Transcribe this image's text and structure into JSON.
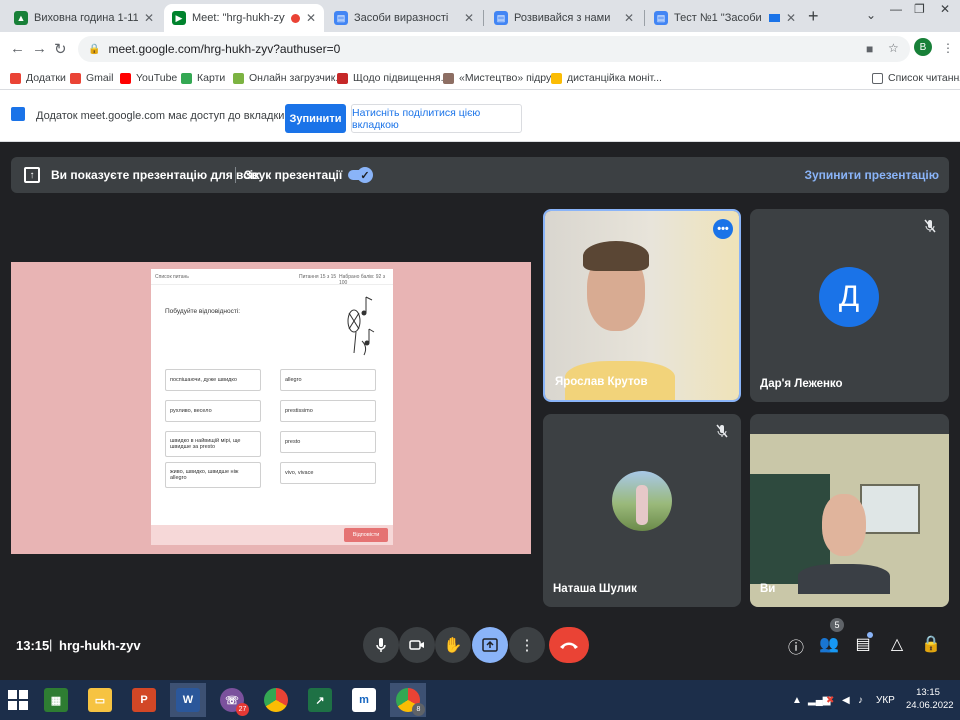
{
  "tabs": [
    {
      "label": "Виховна година 1-11 класи",
      "color": "#188038"
    },
    {
      "label": "Meet: \"hrg-hukh-zyv\"",
      "color": "#00832d"
    },
    {
      "label": "Засоби виразності",
      "color": "#4285f4"
    },
    {
      "label": "Розвивайся з нами",
      "color": "#4285f4"
    },
    {
      "label": "Тест №1 \"Засоби вираз",
      "color": "#4285f4"
    }
  ],
  "address": {
    "url": "meet.google.com/hrg-hukh-zyv?authuser=0"
  },
  "profile_letter": "В",
  "bookmarks": [
    {
      "label": "Додатки",
      "color": "#ea4335"
    },
    {
      "label": "Gmail",
      "color": "#ea4335"
    },
    {
      "label": "YouTube",
      "color": "#ff0000"
    },
    {
      "label": "Карти",
      "color": "#34a853"
    },
    {
      "label": "Онлайн загрузчик...",
      "color": "#7cb342"
    },
    {
      "label": "Щодо підвищення...",
      "color": "#c62828"
    },
    {
      "label": "«Мистецтво» підру...",
      "color": "#8d6e63"
    },
    {
      "label": "дистанційка моніт...",
      "color": "#fbbc04"
    }
  ],
  "reading_list": "Список читання",
  "infobar": {
    "message": "Додаток meet.google.com має доступ до вкладки lyssi.net",
    "stop": "Зупинити",
    "share": "Натисніть поділитися цією вкладкою"
  },
  "banner": {
    "presenting": "Ви показуєте презентацію для всіх",
    "sound": "Звук презентації",
    "stop": "Зупинити презентацію"
  },
  "quiz": {
    "header_left": "Список питань",
    "header_mid": "Питання 15 з 15",
    "header_right": "Набрано балів: 92 з 100",
    "title": "Побудуйте відповідності:",
    "left": [
      "поспішаючи, дуже швидко",
      "рухливо, весело",
      "швидко в найвищій мірі, ще швидше за presto",
      "живо, швидко, швидше ніж allegro"
    ],
    "right": [
      "allegro",
      "prestissimo",
      "presto",
      "vivo, vivace"
    ],
    "answer_btn": "Відповісти"
  },
  "participants": [
    {
      "name": "Ярослав Крутов"
    },
    {
      "name": "Дар'я Леженко",
      "initial": "Д"
    },
    {
      "name": "Наташа Шулик"
    },
    {
      "name": "Ви"
    }
  ],
  "meeting": {
    "time": "13:15",
    "separator": "|",
    "code": "hrg-hukh-zyv",
    "people_count": "5"
  },
  "taskbar": {
    "viber_badge": "27",
    "chrome_badge": "8",
    "lang": "УКР",
    "time": "13:15",
    "date": "24.06.2022"
  }
}
